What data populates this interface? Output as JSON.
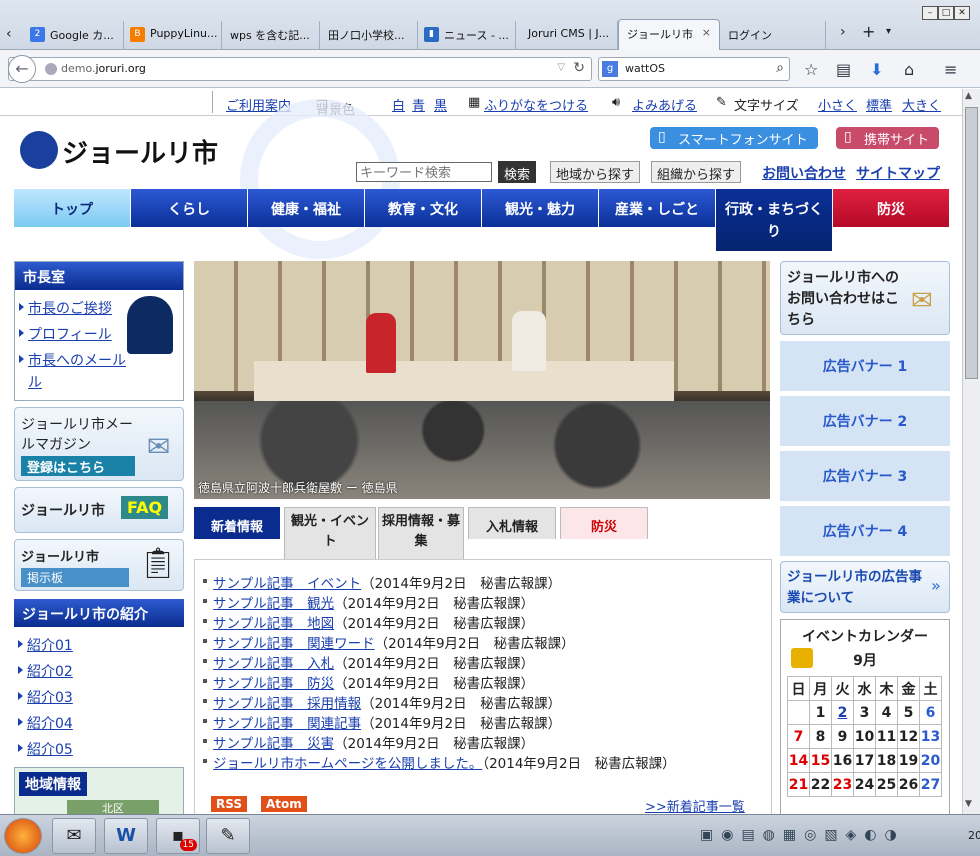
{
  "browser": {
    "tabs": [
      {
        "label": "Google カ...",
        "icon": "google-calendar-icon"
      },
      {
        "label": "PuppyLinu...",
        "icon": "blogger-icon"
      },
      {
        "label": "wps を含む記..."
      },
      {
        "label": "田ノ口小学校..."
      },
      {
        "label": "ニュース - ..."
      },
      {
        "label": "Joruri CMS | J..."
      },
      {
        "label": "ジョールリ市",
        "active": true
      },
      {
        "label": "ログイン"
      }
    ],
    "close_glyph": "×",
    "url_prefix": "demo.",
    "url_host": "joruri.org",
    "search_value": "wattOS"
  },
  "util": {
    "guide": "ご利用案内",
    "bgcolor_label": "背景色",
    "bg_white": "白",
    "bg_blue": "青",
    "bg_black": "黒",
    "furigana": "ふりがなをつける",
    "read_aloud": "よみあげる",
    "font_size_label": "文字サイズ",
    "small": "小さく",
    "standard": "標準",
    "large": "大きく"
  },
  "header": {
    "logo": "ジョールリ市",
    "smartphone": "スマートフォンサイト",
    "mobile": "携帯サイト",
    "keyword_placeholder": "キーワード検索",
    "search_btn": "検索",
    "by_area": "地域から探す",
    "by_org": "組織から探す",
    "contact": "お問い合わせ",
    "sitemap": "サイトマップ"
  },
  "gnav": [
    "トップ",
    "くらし",
    "健康・福祉",
    "教育・文化",
    "観光・魅力",
    "産業・しごと",
    "行政・まちづくり",
    "防災"
  ],
  "left": {
    "mayor_title": "市長室",
    "mayor_links": [
      "市長のご挨拶",
      "プロフィール",
      "市長へのメール"
    ],
    "mail_mag_1": "ジョールリ市メー",
    "mail_mag_2": "ルマガジン",
    "mail_mag_reg": "登録はこちら",
    "faq_label": "ジョールリ市",
    "faq": "FAQ",
    "board_label": "ジョールリ市",
    "board": "掲示板",
    "intro_title": "ジョールリ市の紹介",
    "intro_links": [
      "紹介01",
      "紹介02",
      "紹介03",
      "紹介04",
      "紹介05"
    ],
    "area_title": "地域情報",
    "area_sub": "北区"
  },
  "hero": {
    "caption": "徳島県立阿波十郎兵衛屋敷 ー 徳島県"
  },
  "center_tabs": [
    "新着情報",
    "観光・イベント",
    "採用情報・募集",
    "入札情報",
    "防災"
  ],
  "news": [
    {
      "title": "サンプル記事　イベント",
      "meta": "（2014年9月2日　秘書広報課）"
    },
    {
      "title": "サンプル記事　観光",
      "meta": "（2014年9月2日　秘書広報課）"
    },
    {
      "title": "サンプル記事　地図",
      "meta": "（2014年9月2日　秘書広報課）"
    },
    {
      "title": "サンプル記事　関連ワード",
      "meta": "（2014年9月2日　秘書広報課）"
    },
    {
      "title": "サンプル記事　入札",
      "meta": "（2014年9月2日　秘書広報課）"
    },
    {
      "title": "サンプル記事　防災",
      "meta": "（2014年9月2日　秘書広報課）"
    },
    {
      "title": "サンプル記事　採用情報",
      "meta": "（2014年9月2日　秘書広報課）"
    },
    {
      "title": "サンプル記事　関連記事",
      "meta": "（2014年9月2日　秘書広報課）"
    },
    {
      "title": "サンプル記事　災害",
      "meta": "（2014年9月2日　秘書広報課）"
    },
    {
      "title": "ジョールリ市ホームページを公開しました。",
      "meta": "（2014年9月2日　秘書広報課）"
    }
  ],
  "feeds": {
    "rss": "RSS",
    "atom": "Atom",
    "more": ">>新着記事一覧"
  },
  "right": {
    "contact_box": "ジョールリ市へのお問い合わせはこちら",
    "ads": [
      "広告バナー 1",
      "広告バナー 2",
      "広告バナー 3",
      "広告バナー 4"
    ],
    "ad_about": "ジョールリ市の広告事業について",
    "cal_title": "イベントカレンダー",
    "cal_month": "9月",
    "cal_days": [
      "日",
      "月",
      "火",
      "水",
      "木",
      "金",
      "土"
    ],
    "cal_rows": [
      [
        "",
        "1",
        "2",
        "3",
        "4",
        "5",
        "6"
      ],
      [
        "7",
        "8",
        "9",
        "10",
        "11",
        "12",
        "13"
      ],
      [
        "14",
        "15",
        "16",
        "17",
        "18",
        "19",
        "20"
      ],
      [
        "21",
        "22",
        "23",
        "24",
        "25",
        "26",
        "27"
      ]
    ]
  },
  "taskbar": {
    "badge": "15",
    "clock": "20"
  }
}
